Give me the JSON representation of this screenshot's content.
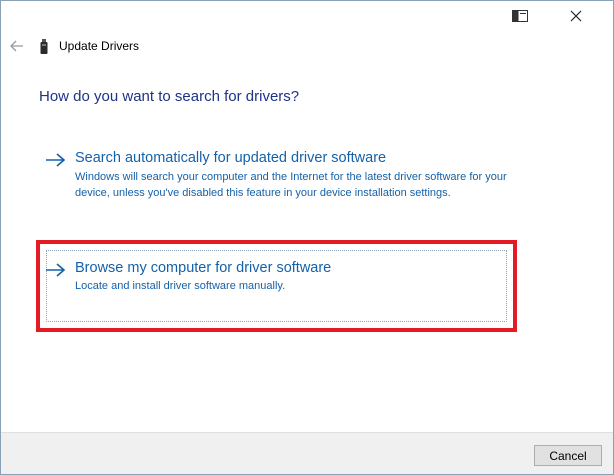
{
  "window": {
    "header_title": "Update Drivers",
    "question": "How do you want to search for drivers?"
  },
  "icons": {
    "back": "back-arrow-icon",
    "device": "usb-device-icon",
    "restore": "restore-window-icon",
    "close": "close-icon",
    "option_arrow": "right-arrow-icon"
  },
  "options": [
    {
      "title": "Search automatically for updated driver software",
      "description": "Windows will search your computer and the Internet for the latest driver software for your device, unless you've disabled this feature in your device installation settings."
    },
    {
      "title": "Browse my computer for driver software",
      "description": "Locate and install driver software manually."
    }
  ],
  "footer": {
    "cancel_label": "Cancel"
  },
  "colors": {
    "link": "#1561a8",
    "question": "#1e3287",
    "highlight": "#e21b25",
    "footer_bg": "#f0f0f0"
  }
}
